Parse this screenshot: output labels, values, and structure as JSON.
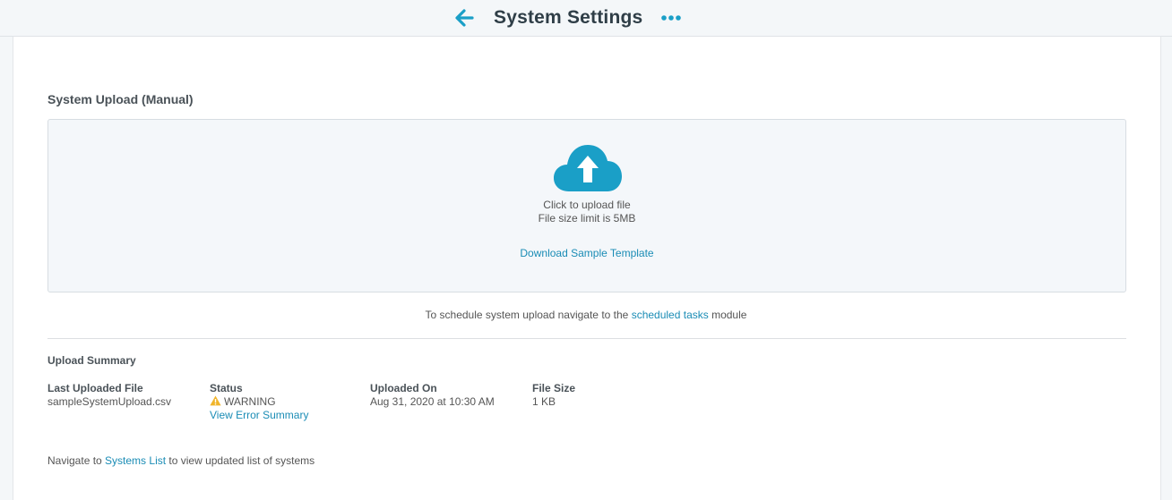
{
  "header": {
    "title": "System Settings",
    "back_icon": "arrow-left-icon",
    "more_icon": "more-horizontal-icon"
  },
  "upload": {
    "section_title": "System Upload (Manual)",
    "icon": "cloud-upload-icon",
    "click_text": "Click to upload file",
    "size_limit_text": "File size limit is 5MB",
    "template_link": "Download Sample Template"
  },
  "schedule": {
    "prefix": "To schedule system upload navigate to the ",
    "link": "scheduled tasks",
    "suffix": " module"
  },
  "summary": {
    "title": "Upload Summary",
    "last_file_label": "Last Uploaded File",
    "last_file_value": "sampleSystemUpload.csv",
    "status_label": "Status",
    "status_value": "WARNING",
    "status_icon": "warning-icon",
    "error_summary_link": "View Error Summary",
    "uploaded_on_label": "Uploaded On",
    "uploaded_on_value": "Aug 31, 2020 at 10:30 AM",
    "file_size_label": "File Size",
    "file_size_value": "1 KB"
  },
  "navigate": {
    "prefix": "Navigate to ",
    "link": "Systems List",
    "suffix": " to view updated list of systems"
  },
  "colors": {
    "accent": "#1a8cb5",
    "cloud": "#1a9fc7",
    "warning": "#f0b429",
    "title": "#2f3e47"
  }
}
